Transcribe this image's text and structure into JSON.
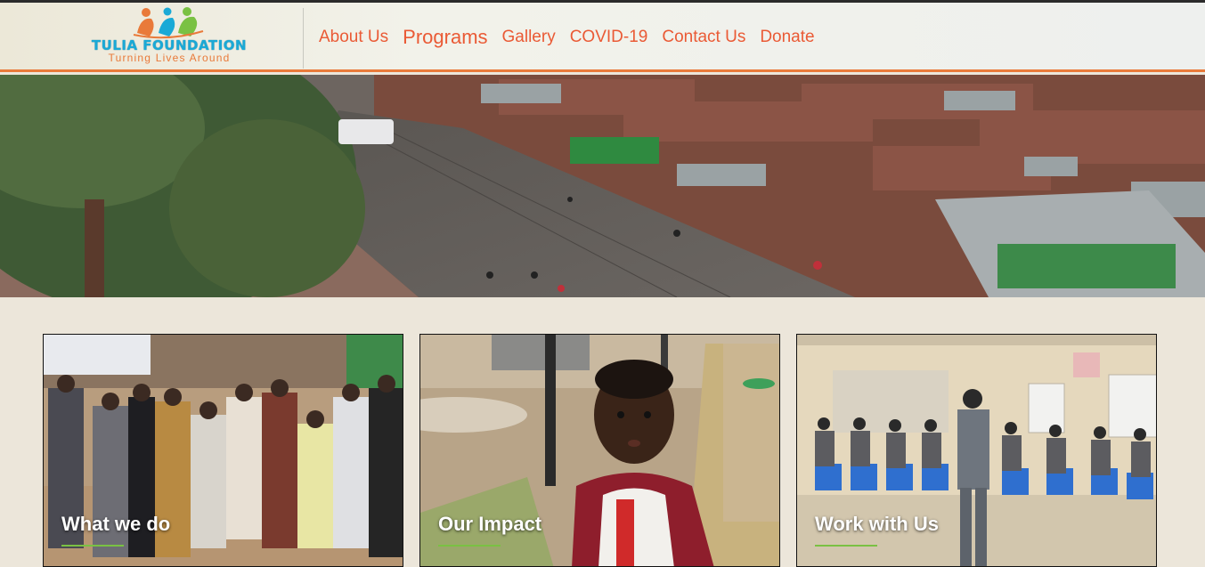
{
  "header": {
    "logo": {
      "brand": "TULIA FOUNDATION",
      "tagline": "Turning Lives Around"
    },
    "nav": [
      {
        "label": "About Us",
        "active": false
      },
      {
        "label": "Programs",
        "active": true
      },
      {
        "label": "Gallery",
        "active": false
      },
      {
        "label": "COVID-19",
        "active": false
      },
      {
        "label": "Contact Us",
        "active": false
      },
      {
        "label": "Donate",
        "active": false
      }
    ],
    "nav_color": "#ea5a35",
    "accent_border": "#e97a3a"
  },
  "hero": {
    "image_subject": "aerial street view with corrugated rooftops"
  },
  "cards": [
    {
      "title": "What we do",
      "image_subject": "group of young women standing outdoors"
    },
    {
      "title": "Our Impact",
      "image_subject": "young child in red and white jacket"
    },
    {
      "title": "Work with Us",
      "image_subject": "youth seated in a circle in a classroom"
    }
  ],
  "colors": {
    "card_underline": "#7ac143",
    "page_background": "#ece6da"
  }
}
